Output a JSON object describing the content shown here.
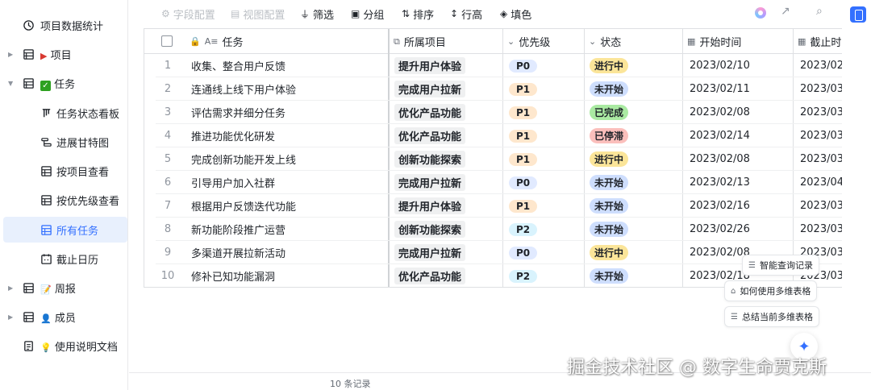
{
  "sidebar": {
    "items": [
      {
        "label": "项目数据统计",
        "icon": "dashboard-icon",
        "expand": ""
      },
      {
        "label": "项目",
        "icon": "table-icon",
        "emoji": "flag",
        "expand": "collapsed"
      },
      {
        "label": "任务",
        "icon": "table-icon",
        "emoji": "check",
        "expand": "expanded"
      },
      {
        "label": "任务状态看板",
        "icon": "kanban-icon",
        "expand": "",
        "child": true
      },
      {
        "label": "进展甘特图",
        "icon": "gantt-icon",
        "expand": "",
        "child": true
      },
      {
        "label": "按项目查看",
        "icon": "grid-icon",
        "expand": "",
        "child": true
      },
      {
        "label": "按优先级查看",
        "icon": "grid-icon",
        "expand": "",
        "child": true
      },
      {
        "label": "所有任务",
        "icon": "grid-icon",
        "expand": "",
        "child": true,
        "active": true
      },
      {
        "label": "截止日历",
        "icon": "calendar-icon",
        "expand": "",
        "child": true
      },
      {
        "label": "周报",
        "icon": "table-icon",
        "emoji": "memo",
        "expand": "collapsed"
      },
      {
        "label": "成员",
        "icon": "table-icon",
        "emoji": "person",
        "expand": "collapsed"
      },
      {
        "label": "使用说明文档",
        "icon": "doc-icon",
        "emoji": "bulb",
        "expand": ""
      }
    ]
  },
  "toolbar": {
    "field_config": "字段配置",
    "view_config": "视图配置",
    "filter": "筛选",
    "group": "分组",
    "sort": "排序",
    "row_height": "行高",
    "fill_color": "填色"
  },
  "table": {
    "columns": [
      "任务",
      "所属项目",
      "优先级",
      "状态",
      "开始时间",
      "截止时"
    ],
    "rows": [
      {
        "num": "1",
        "task": "收集、整合用户反馈",
        "project": "提升用户体验",
        "priority": "P0",
        "status": "进行中",
        "start": "2023/02/10",
        "due": "2023/02/"
      },
      {
        "num": "2",
        "task": "连通线上线下用户体验",
        "project": "完成用户拉新",
        "priority": "P1",
        "status": "未开始",
        "start": "2023/02/11",
        "due": "2023/03/"
      },
      {
        "num": "3",
        "task": "评估需求并细分任务",
        "project": "优化产品功能",
        "priority": "P1",
        "status": "已完成",
        "start": "2023/02/08",
        "due": "2023/03/"
      },
      {
        "num": "4",
        "task": "推进功能优化研发",
        "project": "优化产品功能",
        "priority": "P1",
        "status": "已停滞",
        "start": "2023/02/14",
        "due": "2023/03/"
      },
      {
        "num": "5",
        "task": "完成创新功能开发上线",
        "project": "创新功能探索",
        "priority": "P1",
        "status": "进行中",
        "start": "2023/02/08",
        "due": "2023/03/"
      },
      {
        "num": "6",
        "task": "引导用户加入社群",
        "project": "完成用户拉新",
        "priority": "P0",
        "status": "未开始",
        "start": "2023/02/13",
        "due": "2023/04/"
      },
      {
        "num": "7",
        "task": "根据用户反馈迭代功能",
        "project": "提升用户体验",
        "priority": "P1",
        "status": "未开始",
        "start": "2023/02/16",
        "due": "2023/03/"
      },
      {
        "num": "8",
        "task": "新功能阶段推广运营",
        "project": "创新功能探索",
        "priority": "P2",
        "status": "未开始",
        "start": "2023/02/26",
        "due": "2023/03/"
      },
      {
        "num": "9",
        "task": "多渠道开展拉新活动",
        "project": "完成用户拉新",
        "priority": "P0",
        "status": "进行中",
        "start": "2023/02/08",
        "due": "2023/03/"
      },
      {
        "num": "10",
        "task": "修补已知功能漏洞",
        "project": "优化产品功能",
        "priority": "P2",
        "status": "未开始",
        "start": "2023/02/18",
        "due": "2023/03/"
      }
    ]
  },
  "colors": {
    "P0": "#e1eaff",
    "P1": "#fee7cd",
    "P2": "#d9f3fd",
    "进行中": "#fbe599",
    "未开始": "#cedefd",
    "已完成": "#aaeaa2",
    "已停滞": "#fbbfbc"
  },
  "floating": {
    "smart_query": "智能查询记录",
    "how_to_use": "如何使用多维表格",
    "summarize": "总结当前多维表格"
  },
  "footer": {
    "records": "10 条记录"
  },
  "watermark": "掘金技术社区 @ 数字生命贾克斯"
}
